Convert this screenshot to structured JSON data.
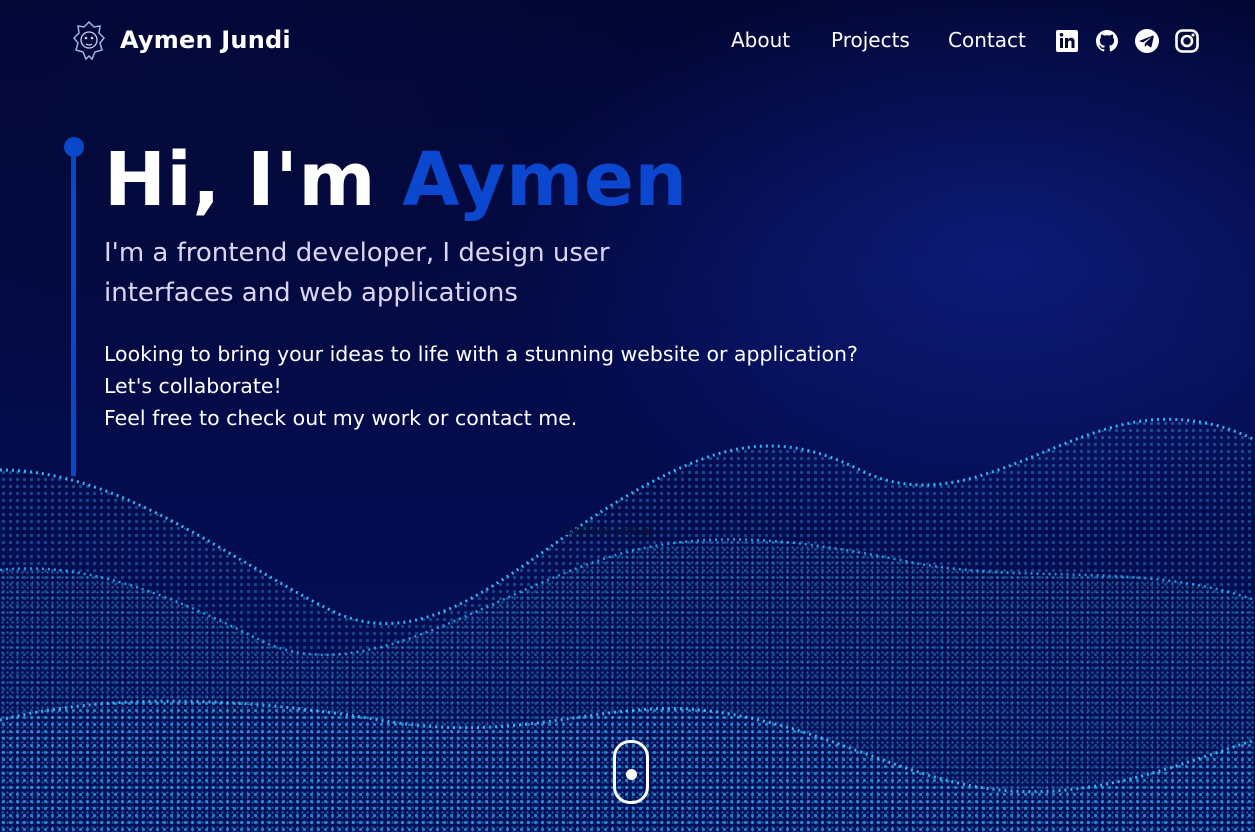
{
  "header": {
    "brand": "Aymen Jundi",
    "logo_icon": "lion-head-icon",
    "nav": [
      {
        "label": "About"
      },
      {
        "label": "Projects"
      },
      {
        "label": "Contact"
      }
    ],
    "socials": [
      {
        "icon": "linkedin-icon"
      },
      {
        "icon": "github-icon"
      },
      {
        "icon": "telegram-icon"
      },
      {
        "icon": "instagram-icon"
      }
    ]
  },
  "hero": {
    "greeting": "Hi, I'm ",
    "name": "Aymen",
    "subtitle": "I'm a frontend developer, I design user interfaces and web applications",
    "lines": [
      "Looking to bring your ideas to life with a stunning website or application?",
      "Let's collaborate!",
      "Feel free to check out my work or contact me."
    ],
    "caption": "Custom Setup"
  },
  "colors": {
    "accent": "#0b48cf",
    "background": "#020a3a",
    "wave_highlight": "#2fb8ff"
  },
  "scroll_icon": "mouse-scroll-icon"
}
